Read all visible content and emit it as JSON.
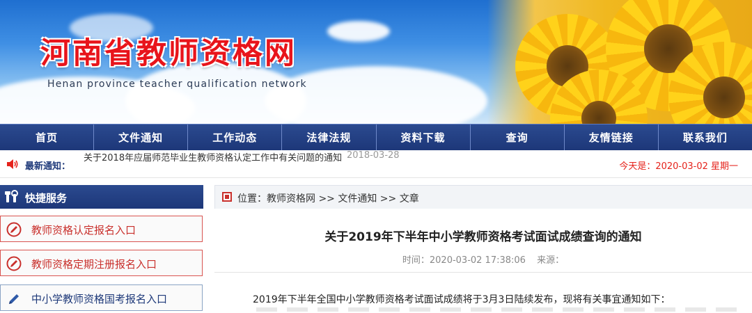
{
  "banner": {
    "title": "河南省教师资格网",
    "subtitle": "Henan province teacher qualification network"
  },
  "nav": {
    "items": [
      "首页",
      "文件通知",
      "工作动态",
      "法律法规",
      "资料下载",
      "查询",
      "友情链接",
      "联系我们"
    ]
  },
  "notice": {
    "label": "最新通知：",
    "text": "关于2018年应届师范毕业生教师资格认定工作中有关问题的通知",
    "date": "2018-03-28",
    "today": "今天是：2020-03-02  星期一"
  },
  "sidebar": {
    "header": "快捷服务",
    "buttons": [
      "教师资格认定报名入口",
      "教师资格定期注册报名入口",
      "中小学教师资格国考报名入口"
    ]
  },
  "main": {
    "breadcrumb": "位置：教师资格网 >> 文件通知 >> 文章",
    "title": "关于2019年下半年中小学教师资格考试面试成绩查询的通知",
    "time": "时间：2020-03-02 17:38:06",
    "source": "来源：",
    "body": "2019年下半年全国中小学教师资格考试面试成绩将于3月3日陆续发布，现将有关事宜通知如下："
  },
  "colors": {
    "nav_bg": "#1d3779",
    "title_red": "#e8141b",
    "accent_red": "#c9302c"
  }
}
